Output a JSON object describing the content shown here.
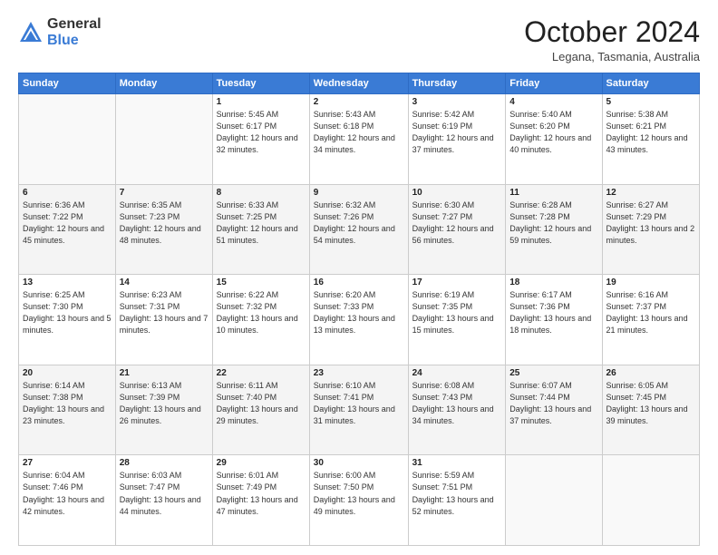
{
  "logo": {
    "general": "General",
    "blue": "Blue"
  },
  "header": {
    "month": "October 2024",
    "location": "Legana, Tasmania, Australia"
  },
  "days_of_week": [
    "Sunday",
    "Monday",
    "Tuesday",
    "Wednesday",
    "Thursday",
    "Friday",
    "Saturday"
  ],
  "weeks": [
    [
      {
        "day": "",
        "info": ""
      },
      {
        "day": "",
        "info": ""
      },
      {
        "day": "1",
        "info": "Sunrise: 5:45 AM\nSunset: 6:17 PM\nDaylight: 12 hours and 32 minutes."
      },
      {
        "day": "2",
        "info": "Sunrise: 5:43 AM\nSunset: 6:18 PM\nDaylight: 12 hours and 34 minutes."
      },
      {
        "day": "3",
        "info": "Sunrise: 5:42 AM\nSunset: 6:19 PM\nDaylight: 12 hours and 37 minutes."
      },
      {
        "day": "4",
        "info": "Sunrise: 5:40 AM\nSunset: 6:20 PM\nDaylight: 12 hours and 40 minutes."
      },
      {
        "day": "5",
        "info": "Sunrise: 5:38 AM\nSunset: 6:21 PM\nDaylight: 12 hours and 43 minutes."
      }
    ],
    [
      {
        "day": "6",
        "info": "Sunrise: 6:36 AM\nSunset: 7:22 PM\nDaylight: 12 hours and 45 minutes."
      },
      {
        "day": "7",
        "info": "Sunrise: 6:35 AM\nSunset: 7:23 PM\nDaylight: 12 hours and 48 minutes."
      },
      {
        "day": "8",
        "info": "Sunrise: 6:33 AM\nSunset: 7:25 PM\nDaylight: 12 hours and 51 minutes."
      },
      {
        "day": "9",
        "info": "Sunrise: 6:32 AM\nSunset: 7:26 PM\nDaylight: 12 hours and 54 minutes."
      },
      {
        "day": "10",
        "info": "Sunrise: 6:30 AM\nSunset: 7:27 PM\nDaylight: 12 hours and 56 minutes."
      },
      {
        "day": "11",
        "info": "Sunrise: 6:28 AM\nSunset: 7:28 PM\nDaylight: 12 hours and 59 minutes."
      },
      {
        "day": "12",
        "info": "Sunrise: 6:27 AM\nSunset: 7:29 PM\nDaylight: 13 hours and 2 minutes."
      }
    ],
    [
      {
        "day": "13",
        "info": "Sunrise: 6:25 AM\nSunset: 7:30 PM\nDaylight: 13 hours and 5 minutes."
      },
      {
        "day": "14",
        "info": "Sunrise: 6:23 AM\nSunset: 7:31 PM\nDaylight: 13 hours and 7 minutes."
      },
      {
        "day": "15",
        "info": "Sunrise: 6:22 AM\nSunset: 7:32 PM\nDaylight: 13 hours and 10 minutes."
      },
      {
        "day": "16",
        "info": "Sunrise: 6:20 AM\nSunset: 7:33 PM\nDaylight: 13 hours and 13 minutes."
      },
      {
        "day": "17",
        "info": "Sunrise: 6:19 AM\nSunset: 7:35 PM\nDaylight: 13 hours and 15 minutes."
      },
      {
        "day": "18",
        "info": "Sunrise: 6:17 AM\nSunset: 7:36 PM\nDaylight: 13 hours and 18 minutes."
      },
      {
        "day": "19",
        "info": "Sunrise: 6:16 AM\nSunset: 7:37 PM\nDaylight: 13 hours and 21 minutes."
      }
    ],
    [
      {
        "day": "20",
        "info": "Sunrise: 6:14 AM\nSunset: 7:38 PM\nDaylight: 13 hours and 23 minutes."
      },
      {
        "day": "21",
        "info": "Sunrise: 6:13 AM\nSunset: 7:39 PM\nDaylight: 13 hours and 26 minutes."
      },
      {
        "day": "22",
        "info": "Sunrise: 6:11 AM\nSunset: 7:40 PM\nDaylight: 13 hours and 29 minutes."
      },
      {
        "day": "23",
        "info": "Sunrise: 6:10 AM\nSunset: 7:41 PM\nDaylight: 13 hours and 31 minutes."
      },
      {
        "day": "24",
        "info": "Sunrise: 6:08 AM\nSunset: 7:43 PM\nDaylight: 13 hours and 34 minutes."
      },
      {
        "day": "25",
        "info": "Sunrise: 6:07 AM\nSunset: 7:44 PM\nDaylight: 13 hours and 37 minutes."
      },
      {
        "day": "26",
        "info": "Sunrise: 6:05 AM\nSunset: 7:45 PM\nDaylight: 13 hours and 39 minutes."
      }
    ],
    [
      {
        "day": "27",
        "info": "Sunrise: 6:04 AM\nSunset: 7:46 PM\nDaylight: 13 hours and 42 minutes."
      },
      {
        "day": "28",
        "info": "Sunrise: 6:03 AM\nSunset: 7:47 PM\nDaylight: 13 hours and 44 minutes."
      },
      {
        "day": "29",
        "info": "Sunrise: 6:01 AM\nSunset: 7:49 PM\nDaylight: 13 hours and 47 minutes."
      },
      {
        "day": "30",
        "info": "Sunrise: 6:00 AM\nSunset: 7:50 PM\nDaylight: 13 hours and 49 minutes."
      },
      {
        "day": "31",
        "info": "Sunrise: 5:59 AM\nSunset: 7:51 PM\nDaylight: 13 hours and 52 minutes."
      },
      {
        "day": "",
        "info": ""
      },
      {
        "day": "",
        "info": ""
      }
    ]
  ]
}
